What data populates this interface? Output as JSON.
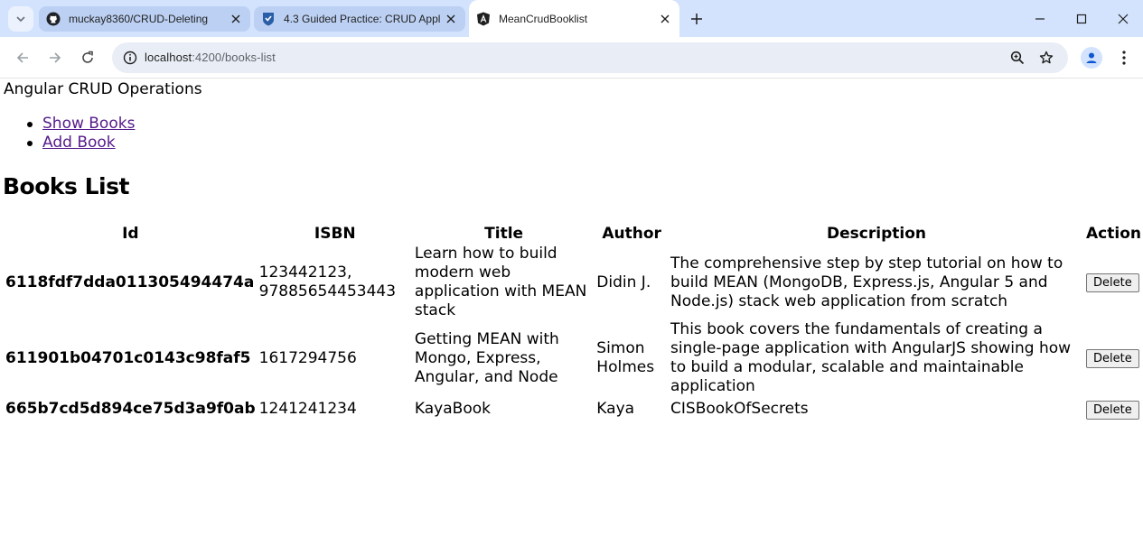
{
  "browser": {
    "tabs": [
      {
        "title": "muckay8360/CRUD-Deleting",
        "icon": "github-icon",
        "active": false
      },
      {
        "title": "4.3 Guided Practice: CRUD Appl",
        "icon": "course-shield-icon",
        "active": false
      },
      {
        "title": "MeanCrudBooklist",
        "icon": "angular-icon",
        "active": true
      }
    ],
    "url_host": "localhost",
    "url_path": ":4200/books-list"
  },
  "app": {
    "title": "Angular CRUD Operations",
    "nav": [
      {
        "label": "Show Books"
      },
      {
        "label": "Add Book"
      }
    ]
  },
  "books": {
    "heading": "Books List",
    "columns": [
      "Id",
      "ISBN",
      "Title",
      "Author",
      "Description",
      "Action"
    ],
    "rows": [
      {
        "id": "6118fdf7dda011305494474a",
        "isbn": "123442123, 97885654453443",
        "title": "Learn how to build modern web application with MEAN stack",
        "author": "Didin J.",
        "description": "The comprehensive step by step tutorial on how to build MEAN (MongoDB, Express.js, Angular 5 and Node.js) stack web application from scratch",
        "action": "Delete"
      },
      {
        "id": "611901b04701c0143c98faf5",
        "isbn": "1617294756",
        "title": "Getting MEAN with Mongo, Express, Angular, and Node",
        "author": "Simon Holmes",
        "description": "This book covers the fundamentals of creating a single-page application with AngularJS showing how to build a modular, scalable and maintainable application",
        "action": "Delete"
      },
      {
        "id": "665b7cd5d894ce75d3a9f0ab",
        "isbn": "1241241234",
        "title": "KayaBook",
        "author": "Kaya",
        "description": "CISBookOfSecrets",
        "action": "Delete"
      }
    ]
  }
}
